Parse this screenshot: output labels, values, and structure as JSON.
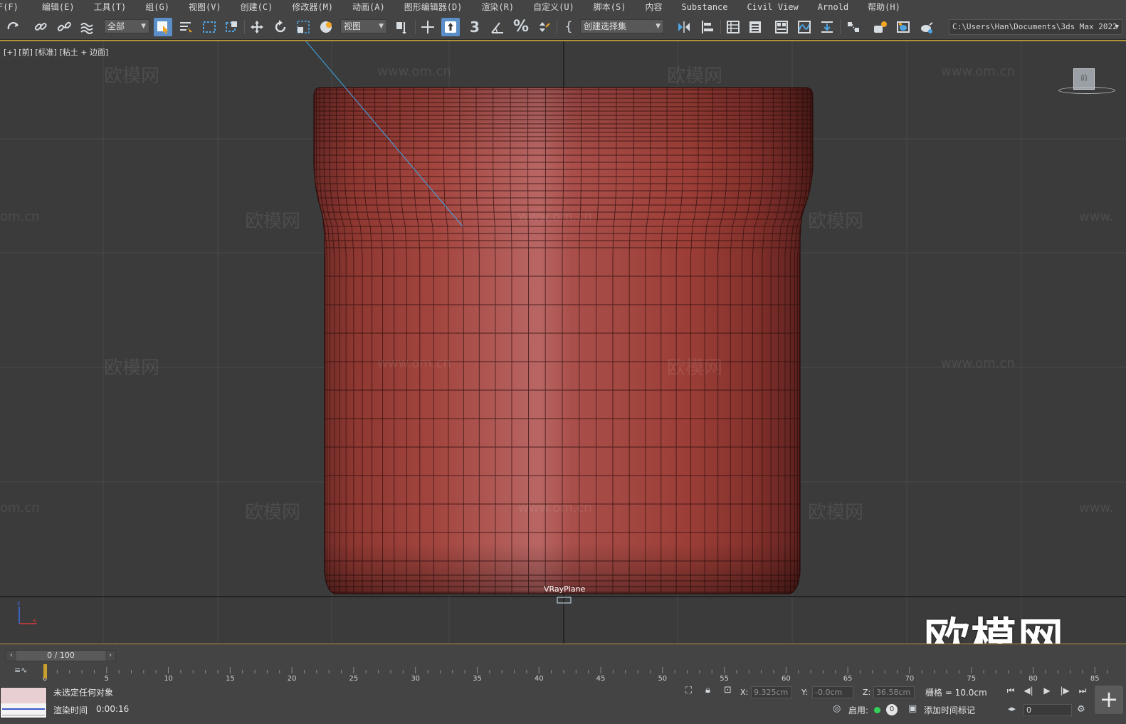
{
  "menu": {
    "items": [
      "F(F)",
      "编辑(E)",
      "工具(T)",
      "组(G)",
      "视图(V)",
      "创建(C)",
      "修改器(M)",
      "动画(A)",
      "图形编辑器(D)",
      "渲染(R)",
      "自定义(U)",
      "脚本(S)",
      "内容",
      "Substance",
      "Civil View",
      "Arnold",
      "帮助(H)"
    ]
  },
  "toolbar": {
    "selection_filter": "全部",
    "ref_coord": "视图",
    "named_selection": "创建选择集",
    "project_path": "C:\\Users\\Han\\Documents\\3ds Max 2022",
    "snap_number": "3",
    "icons": [
      "redo-icon",
      "link-icon",
      "unlink-icon",
      "bind-space-warp-icon",
      "select-icon",
      "select-by-name-icon",
      "rect-select-icon",
      "window-crossing-icon",
      "move-icon",
      "rotate-icon",
      "scale-icon",
      "placement-icon",
      "pivot-icon",
      "snap-toggle-icon",
      "angle-snap-icon",
      "percent-snap-icon",
      "spinner-snap-icon",
      "edit-named-sets-icon",
      "mirror-icon",
      "align-icon",
      "scene-explorer-icon",
      "layer-explorer-icon",
      "ribbon-icon",
      "curve-editor-icon",
      "schematic-icon",
      "material-editor-icon",
      "render-setup-icon",
      "render-frame-icon",
      "render-icon"
    ]
  },
  "viewport": {
    "label": "[+] [前] [标准] [粘土 + 边面]",
    "object_label": "VRayPlane",
    "viewcube_face": "前",
    "watermark_cn": "欧模网",
    "watermark_url": "www.om.cn",
    "watermark_url_short": "om.cn",
    "watermark_url_partial": "www.",
    "big_logo": "欧模网",
    "model_color": "#8f3a35",
    "background_color": "#3b3b3b"
  },
  "timeline": {
    "slider_text": "0 / 100",
    "ticks": [
      "0",
      "5",
      "10",
      "15",
      "20",
      "25",
      "30",
      "35",
      "40",
      "45",
      "50",
      "55",
      "60",
      "65",
      "70",
      "75",
      "80",
      "85"
    ]
  },
  "status": {
    "selection": "未选定任何对象",
    "render_time_label": "渲染时间",
    "render_time": "0:00:16",
    "x_label": "X:",
    "x_value": "9.325cm",
    "y_label": "Y:",
    "y_value": "-0.0cm",
    "z_label": "Z:",
    "z_value": "36.58cm",
    "grid": "栅格 = 10.0cm",
    "enable_label": "启用:",
    "enable_count": "0",
    "add_time_tag": "添加时间标记",
    "frame": "0"
  }
}
